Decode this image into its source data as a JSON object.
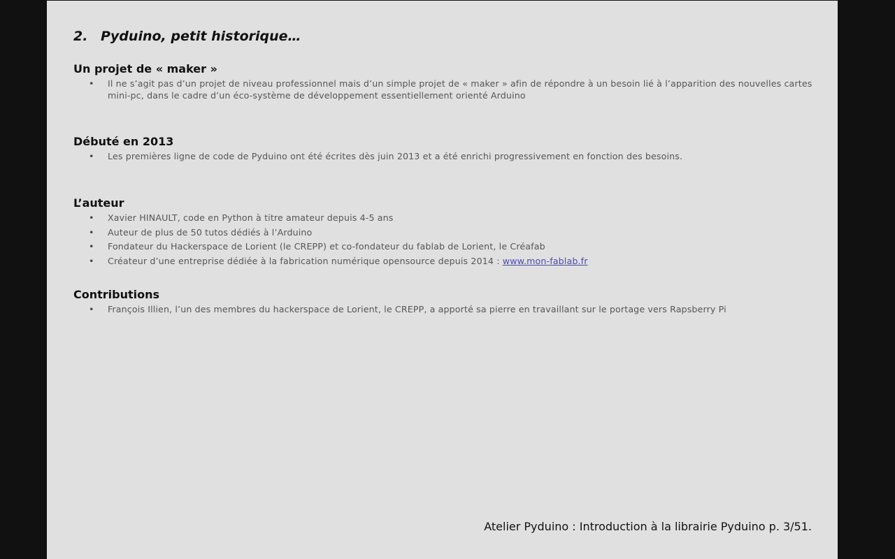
{
  "page": {
    "title_number": "2.",
    "title_text": "Pyduino, petit historique…",
    "sections": [
      {
        "heading": "Un projet de « maker »",
        "items": [
          "Il ne s’agit pas d’un projet de niveau professionnel mais d’un simple projet de « maker » afin de répondre à un besoin lié à l’apparition des nouvelles cartes mini-pc, dans le cadre d’un éco-système de développement essentiellement orienté Arduino"
        ]
      },
      {
        "heading": "Débuté en 2013",
        "items": [
          "Les premières ligne de code de Pyduino ont été écrites dès juin 2013 et a été enrichi progressivement en fonction des besoins."
        ]
      },
      {
        "heading": "L’auteur",
        "items": [
          "Xavier HINAULT, code en Python à titre amateur depuis 4-5 ans",
          "Auteur de plus de 50 tutos dédiés à l’Arduino",
          "Fondateur du Hackerspace de Lorient (le CREPP) et co-fondateur du fablab de Lorient, le Créafab",
          "Créateur d’une entreprise dédiée à la fabrication numérique opensource depuis 2014 : "
        ],
        "link": "www.mon-fablab.fr"
      },
      {
        "heading": "Contributions",
        "items": [
          "François Illien, l’un des membres du hackerspace de Lorient, le CREPP, a apporté sa pierre en travaillant sur le portage vers Rapsberry Pi"
        ]
      }
    ],
    "footer": "Atelier Pyduino : Introduction à la librairie Pyduino p. 3/51."
  },
  "colors": {
    "page_background": "#e0e0e0",
    "outer_background": "#111111",
    "link": "#4a4ab0"
  }
}
